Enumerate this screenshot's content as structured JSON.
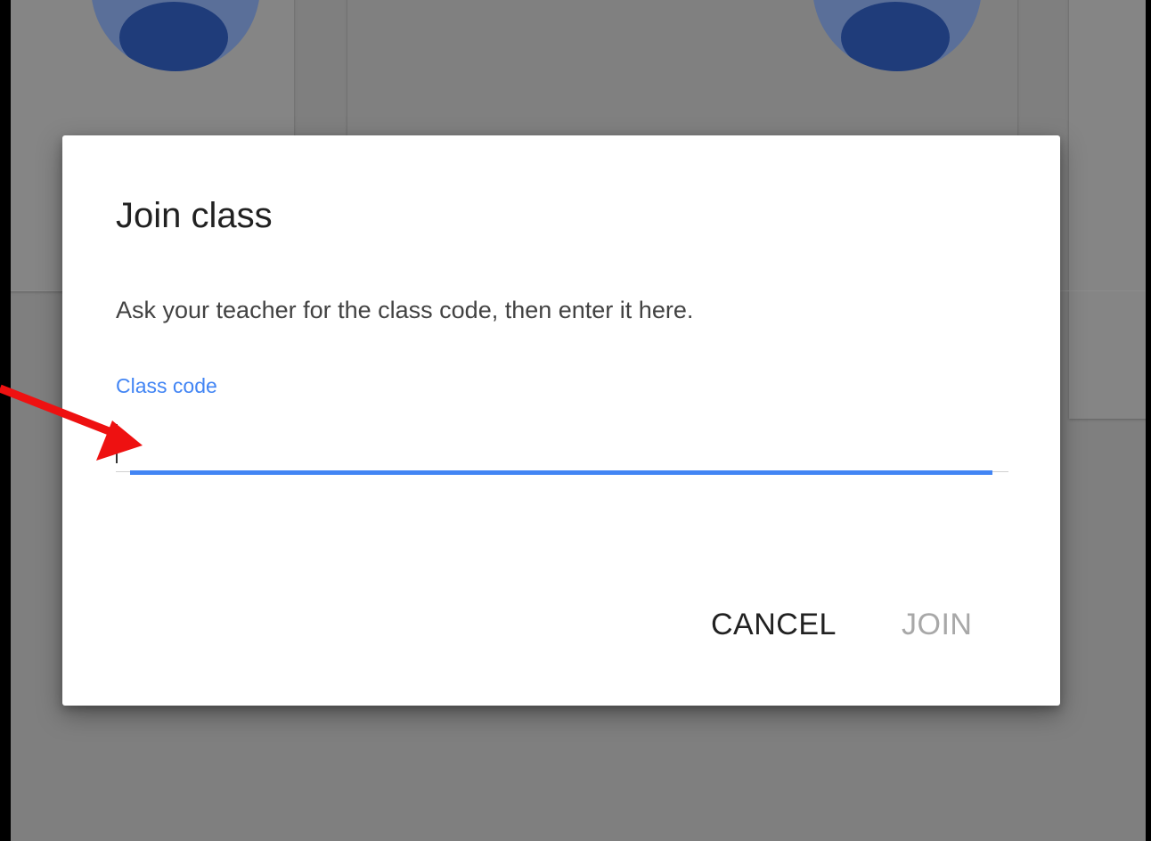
{
  "dialog": {
    "title": "Join class",
    "description": "Ask your teacher for the class code, then enter it here.",
    "field": {
      "label": "Class code",
      "value": "",
      "placeholder": ""
    },
    "buttons": {
      "cancel": "CANCEL",
      "join": "JOIN"
    }
  },
  "colors": {
    "accent": "#4285f4",
    "annotation_arrow": "#ee1111",
    "disabled_text": "#a8a8a8",
    "overlay": "#7f7f7f"
  },
  "icons": {
    "annotation": "red-arrow-icon"
  }
}
